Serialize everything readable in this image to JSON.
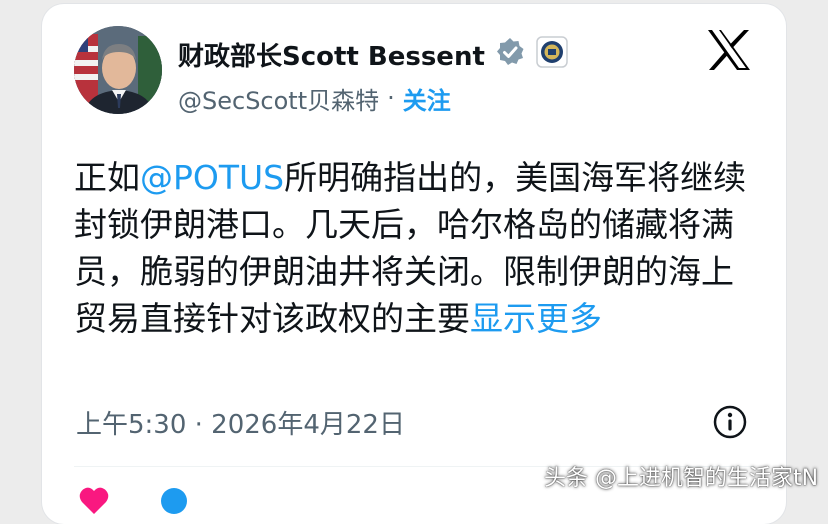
{
  "tweet": {
    "display_name": "财政部长Scott Bessent",
    "handle": "@SecScott贝森特",
    "separator": "·",
    "follow_label": "关注",
    "text_before": "正如",
    "mention": "@POTUS",
    "text_after": "所明确指出的，美国海军将继续封锁伊朗港口。几天后，哈尔格岛的储藏将满员，脆弱的伊朗油井将关闭。限制伊朗的海上贸易直接针对该政权的主要",
    "show_more_label": "显示更多",
    "timestamp": "上午5:30 · 2026年4月22日",
    "like_count": "",
    "reply_count": ""
  },
  "icons": {
    "verified": "verified-badge-icon",
    "affiliation": "treasury-seal-icon",
    "platform": "x-logo-icon",
    "info": "info-icon"
  },
  "colors": {
    "accent": "#1d9bf0",
    "text": "#0f1419",
    "muted": "#536471",
    "like": "#f91880"
  },
  "watermark": {
    "text": "头条 @上进机智的生活家tN"
  }
}
